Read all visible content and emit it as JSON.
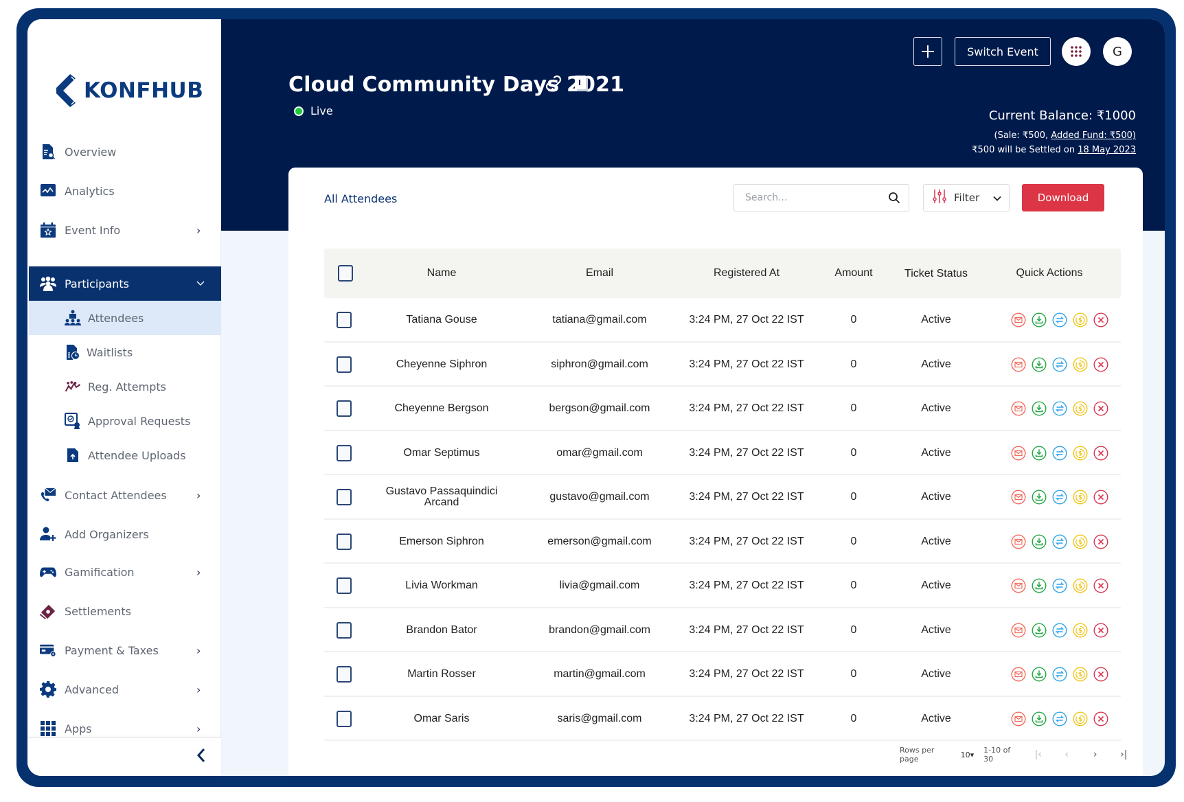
{
  "app": {
    "logo_text": "KONFHUB"
  },
  "sidebar": {
    "items": [
      {
        "label": "Overview",
        "icon": "overview-document-search-icon",
        "has_chevron": false
      },
      {
        "label": "Analytics",
        "icon": "analytics-chart-icon",
        "has_chevron": true
      },
      {
        "label": "Event Info",
        "icon": "calendar-star-icon",
        "has_chevron": true
      },
      {
        "label": "Participants",
        "icon": "people-group-icon",
        "expanded": true
      },
      {
        "label": "Contact Attendees",
        "icon": "phone-mail-icon",
        "has_chevron": true
      },
      {
        "label": "Add Organizers",
        "icon": "user-plus-icon",
        "has_chevron": false
      },
      {
        "label": "Gamification",
        "icon": "gamepad-icon",
        "has_chevron": true
      },
      {
        "label": "Settlements",
        "icon": "money-icon",
        "has_chevron": false
      },
      {
        "label": "Payment & Taxes",
        "icon": "card-gear-icon",
        "has_chevron": true
      },
      {
        "label": "Advanced",
        "icon": "gear-icon",
        "has_chevron": true
      },
      {
        "label": "Apps",
        "icon": "grid-icon",
        "has_chevron": true
      }
    ],
    "participants_sub": [
      {
        "label": "Attendees",
        "icon": "attendees-icon",
        "selected": true
      },
      {
        "label": "Waitlists",
        "icon": "waitlist-clock-icon"
      },
      {
        "label": "Reg. Attempts",
        "icon": "reg-attempts-icon"
      },
      {
        "label": "Approval Requests",
        "icon": "approval-icon"
      },
      {
        "label": "Attendee Uploads",
        "icon": "file-upload-icon"
      }
    ],
    "chevron_right": "›",
    "chevron_down": "⌄",
    "collapse_icon": "‹"
  },
  "header": {
    "event_title": "Cloud Community Days 2021",
    "status": "Live",
    "add_label": "+",
    "switch_event_label": "Switch Event",
    "avatar_initial": "G",
    "balance": {
      "current": "Current Balance: ₹1000",
      "sale_prefix": "(Sale: ₹500, ",
      "added_fund": "Added Fund: ₹500)",
      "settle_prefix": "₹500 will be Settled on ",
      "settle_date": "18 May 2023"
    }
  },
  "main": {
    "card_title": "All Attendees",
    "search_placeholder": "Search...",
    "filter_label": "Filter",
    "download_label": "Download",
    "columns": [
      "Name",
      "Email",
      "Registered At",
      "Amount",
      "Ticket Status",
      "Quick Actions"
    ],
    "rows": [
      {
        "name": "Tatiana Gouse",
        "email": "tatiana@gmail.com",
        "registered_at": "3:24 PM, 27 Oct 22 IST",
        "amount": "0",
        "status": "Active"
      },
      {
        "name": "Cheyenne Siphron",
        "email": "siphron@gmail.com",
        "registered_at": "3:24 PM, 27 Oct 22 IST",
        "amount": "0",
        "status": "Active"
      },
      {
        "name": "Cheyenne Bergson",
        "email": "bergson@gmail.com",
        "registered_at": "3:24 PM, 27 Oct 22 IST",
        "amount": "0",
        "status": "Active"
      },
      {
        "name": "Omar Septimus",
        "email": "omar@gmail.com",
        "registered_at": "3:24 PM, 27 Oct 22 IST",
        "amount": "0",
        "status": "Active"
      },
      {
        "name": "Gustavo Passaquindici Arcand",
        "email": "gustavo@gmail.com",
        "registered_at": "3:24 PM, 27 Oct 22 IST",
        "amount": "0",
        "status": "Active"
      },
      {
        "name": "Emerson Siphron",
        "email": "emerson@gmail.com",
        "registered_at": "3:24 PM, 27 Oct 22 IST",
        "amount": "0",
        "status": "Active"
      },
      {
        "name": "Livia Workman",
        "email": "livia@gmail.com",
        "registered_at": "3:24 PM, 27 Oct 22 IST",
        "amount": "0",
        "status": "Active"
      },
      {
        "name": "Brandon Bator",
        "email": "brandon@gmail.com",
        "registered_at": "3:24 PM, 27 Oct 22 IST",
        "amount": "0",
        "status": "Active"
      },
      {
        "name": "Martin Rosser",
        "email": "martin@gmail.com",
        "registered_at": "3:24 PM, 27 Oct 22 IST",
        "amount": "0",
        "status": "Active"
      },
      {
        "name": "Omar Saris",
        "email": "saris@gmail.com",
        "registered_at": "3:24 PM, 27 Oct 22 IST",
        "amount": "0",
        "status": "Active"
      }
    ],
    "quick_actions": [
      {
        "name": "send-email-icon",
        "color": "#f06a5a"
      },
      {
        "name": "download-ticket-icon",
        "color": "#22a845"
      },
      {
        "name": "transfer-ticket-icon",
        "color": "#2fa3e8"
      },
      {
        "name": "refund-icon",
        "color": "#f0c419"
      },
      {
        "name": "cancel-ticket-icon",
        "color": "#d9354f"
      }
    ],
    "pagination": {
      "rows_per_page_label": "Rows per page",
      "rows_per_page_value": "10▾",
      "range": "1-10 of 30",
      "first": "|‹",
      "prev": "‹",
      "next": "›",
      "last": "›|"
    }
  },
  "colors": {
    "frame": "#05316f",
    "header_bg": "#001a4b",
    "active_nav": "#08316e",
    "download_btn": "#dc3545",
    "live_dot": "#1fc93a"
  }
}
